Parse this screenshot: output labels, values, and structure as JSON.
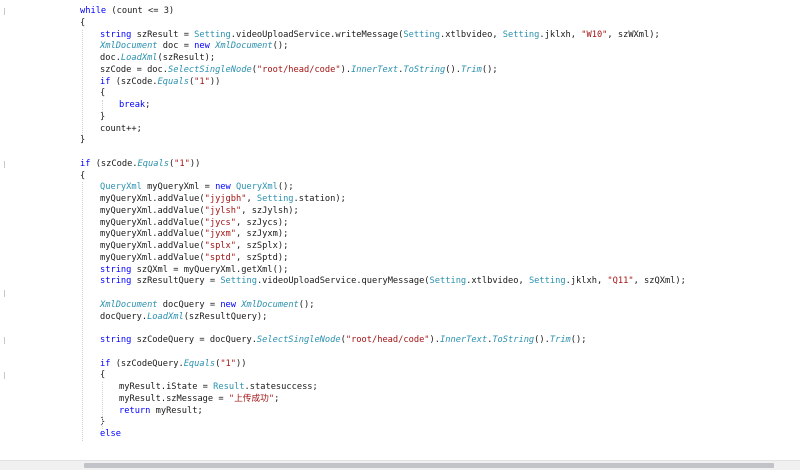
{
  "editor": {
    "lines": [
      {
        "i": 2,
        "tokens": [
          {
            "t": "while",
            "c": "kw"
          },
          {
            "t": " (count <= 3)"
          }
        ]
      },
      {
        "i": 2,
        "tokens": [
          {
            "t": "{"
          }
        ]
      },
      {
        "i": 3,
        "tokens": [
          {
            "t": "string",
            "c": "kw"
          },
          {
            "t": " szResult = "
          },
          {
            "t": "Setting",
            "c": "type"
          },
          {
            "t": ".videoUploadService.writeMessage("
          },
          {
            "t": "Setting",
            "c": "type"
          },
          {
            "t": ".xtlbvideo, "
          },
          {
            "t": "Setting",
            "c": "type"
          },
          {
            "t": ".jklxh, "
          },
          {
            "t": "\"W10\"",
            "c": "str"
          },
          {
            "t": ", szWXml);"
          }
        ]
      },
      {
        "i": 3,
        "tokens": [
          {
            "t": "XmlDocument",
            "c": "it"
          },
          {
            "t": " doc = "
          },
          {
            "t": "new",
            "c": "kw"
          },
          {
            "t": " "
          },
          {
            "t": "XmlDocument",
            "c": "it"
          },
          {
            "t": "();"
          }
        ]
      },
      {
        "i": 3,
        "tokens": [
          {
            "t": "doc."
          },
          {
            "t": "LoadXml",
            "c": "it"
          },
          {
            "t": "(szResult);"
          }
        ]
      },
      {
        "i": 3,
        "tokens": [
          {
            "t": "szCode = doc."
          },
          {
            "t": "SelectSingleNode",
            "c": "it"
          },
          {
            "t": "("
          },
          {
            "t": "\"root/head/code\"",
            "c": "str"
          },
          {
            "t": ")."
          },
          {
            "t": "InnerText",
            "c": "it"
          },
          {
            "t": "."
          },
          {
            "t": "ToString",
            "c": "it"
          },
          {
            "t": "()."
          },
          {
            "t": "Trim",
            "c": "it"
          },
          {
            "t": "();"
          }
        ]
      },
      {
        "i": 3,
        "tokens": [
          {
            "t": "if",
            "c": "kw"
          },
          {
            "t": " (szCode."
          },
          {
            "t": "Equals",
            "c": "it"
          },
          {
            "t": "("
          },
          {
            "t": "\"1\"",
            "c": "str"
          },
          {
            "t": "))"
          }
        ]
      },
      {
        "i": 3,
        "tokens": [
          {
            "t": "{"
          }
        ]
      },
      {
        "i": 4,
        "tokens": [
          {
            "t": "break",
            "c": "kw"
          },
          {
            "t": ";"
          }
        ]
      },
      {
        "i": 3,
        "tokens": [
          {
            "t": "}"
          }
        ]
      },
      {
        "i": 3,
        "tokens": [
          {
            "t": "count++;"
          }
        ]
      },
      {
        "i": 2,
        "tokens": [
          {
            "t": "}"
          }
        ]
      },
      {
        "i": 0,
        "tokens": []
      },
      {
        "i": 2,
        "tokens": [
          {
            "t": "if",
            "c": "kw"
          },
          {
            "t": " (szCode."
          },
          {
            "t": "Equals",
            "c": "it"
          },
          {
            "t": "("
          },
          {
            "t": "\"1\"",
            "c": "str"
          },
          {
            "t": "))"
          }
        ]
      },
      {
        "i": 2,
        "tokens": [
          {
            "t": "{"
          }
        ]
      },
      {
        "i": 3,
        "tokens": [
          {
            "t": "QueryXml",
            "c": "type"
          },
          {
            "t": " myQueryXml = "
          },
          {
            "t": "new",
            "c": "kw"
          },
          {
            "t": " "
          },
          {
            "t": "QueryXml",
            "c": "type"
          },
          {
            "t": "();"
          }
        ]
      },
      {
        "i": 3,
        "tokens": [
          {
            "t": "myQueryXml.addValue("
          },
          {
            "t": "\"jyjgbh\"",
            "c": "str"
          },
          {
            "t": ", "
          },
          {
            "t": "Setting",
            "c": "type"
          },
          {
            "t": ".station);"
          }
        ]
      },
      {
        "i": 3,
        "tokens": [
          {
            "t": "myQueryXml.addValue("
          },
          {
            "t": "\"jylsh\"",
            "c": "str"
          },
          {
            "t": ", szJylsh);"
          }
        ]
      },
      {
        "i": 3,
        "tokens": [
          {
            "t": "myQueryXml.addValue("
          },
          {
            "t": "\"jycs\"",
            "c": "str"
          },
          {
            "t": ", szJycs);"
          }
        ]
      },
      {
        "i": 3,
        "tokens": [
          {
            "t": "myQueryXml.addValue("
          },
          {
            "t": "\"jyxm\"",
            "c": "str"
          },
          {
            "t": ", szJyxm);"
          }
        ]
      },
      {
        "i": 3,
        "tokens": [
          {
            "t": "myQueryXml.addValue("
          },
          {
            "t": "\"splx\"",
            "c": "str"
          },
          {
            "t": ", szSplx);"
          }
        ]
      },
      {
        "i": 3,
        "tokens": [
          {
            "t": "myQueryXml.addValue("
          },
          {
            "t": "\"sptd\"",
            "c": "str"
          },
          {
            "t": ", szSptd);"
          }
        ]
      },
      {
        "i": 3,
        "tokens": [
          {
            "t": "string",
            "c": "kw"
          },
          {
            "t": " szQXml = myQueryXml.getXml();"
          }
        ]
      },
      {
        "i": 3,
        "tokens": [
          {
            "t": "string",
            "c": "kw"
          },
          {
            "t": " szResultQuery = "
          },
          {
            "t": "Setting",
            "c": "type"
          },
          {
            "t": ".videoUploadService.queryMessage("
          },
          {
            "t": "Setting",
            "c": "type"
          },
          {
            "t": ".xtlbvideo, "
          },
          {
            "t": "Setting",
            "c": "type"
          },
          {
            "t": ".jklxh, "
          },
          {
            "t": "\"Q11\"",
            "c": "str"
          },
          {
            "t": ", szQXml);"
          }
        ]
      },
      {
        "i": 0,
        "tokens": []
      },
      {
        "i": 3,
        "tokens": [
          {
            "t": "XmlDocument",
            "c": "it"
          },
          {
            "t": " docQuery = "
          },
          {
            "t": "new",
            "c": "kw"
          },
          {
            "t": " "
          },
          {
            "t": "XmlDocument",
            "c": "it"
          },
          {
            "t": "();"
          }
        ]
      },
      {
        "i": 3,
        "tokens": [
          {
            "t": "docQuery."
          },
          {
            "t": "LoadXml",
            "c": "it"
          },
          {
            "t": "(szResultQuery);"
          }
        ]
      },
      {
        "i": 0,
        "tokens": []
      },
      {
        "i": 3,
        "tokens": [
          {
            "t": "string",
            "c": "kw"
          },
          {
            "t": " szCodeQuery = docQuery."
          },
          {
            "t": "SelectSingleNode",
            "c": "it"
          },
          {
            "t": "("
          },
          {
            "t": "\"root/head/code\"",
            "c": "str"
          },
          {
            "t": ")."
          },
          {
            "t": "InnerText",
            "c": "it"
          },
          {
            "t": "."
          },
          {
            "t": "ToString",
            "c": "it"
          },
          {
            "t": "()."
          },
          {
            "t": "Trim",
            "c": "it"
          },
          {
            "t": "();"
          }
        ]
      },
      {
        "i": 0,
        "tokens": []
      },
      {
        "i": 3,
        "tokens": [
          {
            "t": "if",
            "c": "kw"
          },
          {
            "t": " (szCodeQuery."
          },
          {
            "t": "Equals",
            "c": "it"
          },
          {
            "t": "("
          },
          {
            "t": "\"1\"",
            "c": "str"
          },
          {
            "t": "))"
          }
        ]
      },
      {
        "i": 3,
        "tokens": [
          {
            "t": "{"
          }
        ]
      },
      {
        "i": 4,
        "tokens": [
          {
            "t": "myResult.iState = "
          },
          {
            "t": "Result",
            "c": "type"
          },
          {
            "t": ".statesuccess;"
          }
        ]
      },
      {
        "i": 4,
        "tokens": [
          {
            "t": "myResult.szMessage = "
          },
          {
            "t": "\"上传成功\"",
            "c": "str"
          },
          {
            "t": ";"
          }
        ]
      },
      {
        "i": 4,
        "tokens": [
          {
            "t": "return",
            "c": "kw"
          },
          {
            "t": " myResult;"
          }
        ]
      },
      {
        "i": 3,
        "tokens": [
          {
            "t": "}"
          }
        ]
      },
      {
        "i": 3,
        "tokens": [
          {
            "t": "else",
            "c": "kw"
          }
        ]
      }
    ]
  },
  "colors": {
    "keyword": "#0000ff",
    "type": "#2b91af",
    "string": "#a31515",
    "text": "#1a1a1a"
  }
}
